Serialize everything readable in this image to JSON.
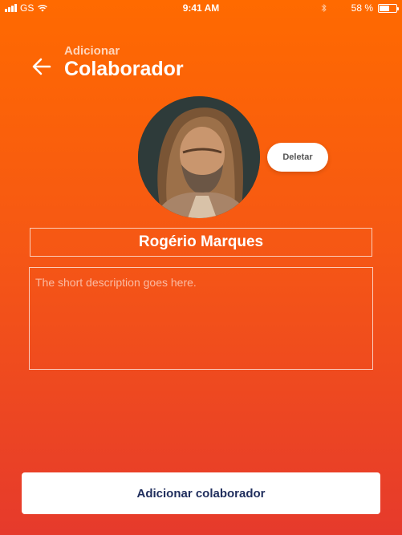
{
  "status_bar": {
    "carrier": "GS",
    "time": "9:41 AM",
    "battery_percent": "58 %",
    "battery_level": 0.58
  },
  "header": {
    "subtitle": "Adicionar",
    "title": "Colaborador",
    "back_icon": "arrow-left-icon"
  },
  "profile": {
    "avatar_icon": "profile-photo",
    "delete_label": "Deletar",
    "name_value": "Rogério Marques",
    "description_placeholder": "The short description goes here.",
    "description_value": ""
  },
  "actions": {
    "submit_label": "Adicionar colaborador"
  },
  "colors": {
    "gradient_top": "#FF6A00",
    "gradient_bottom": "#E63A2C",
    "button_text": "#1F2D5C"
  }
}
